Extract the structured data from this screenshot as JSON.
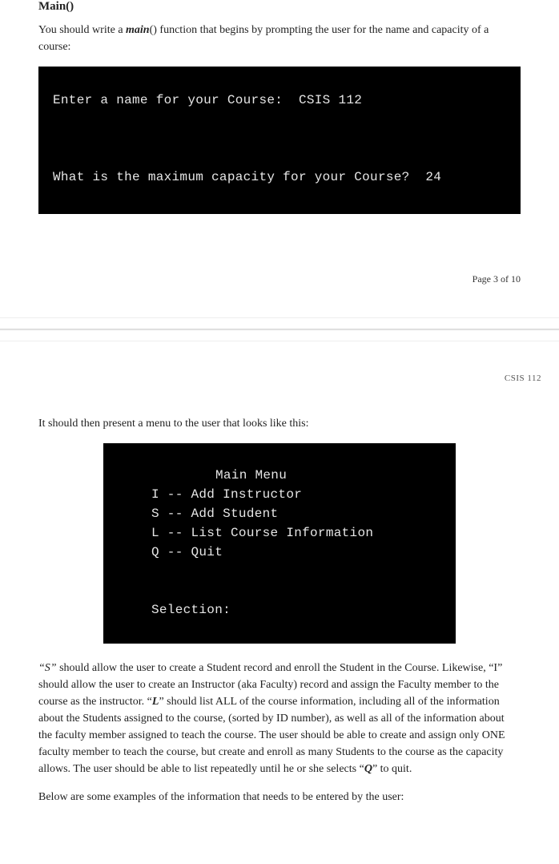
{
  "heading": "Main()",
  "intro_pre": "You should write a ",
  "intro_main": "main",
  "intro_post": "() function that begins by prompting the user for the name and capacity of a course:",
  "console1_line1": "Enter a name for your Course:  CSIS 112",
  "console1_line2": "What is the maximum capacity for your Course?  24",
  "page_num": "Page 3 of 10",
  "course_code": "CSIS 112",
  "menu_intro": "It should then present a menu to the user that looks like this:",
  "menu_title": "Main Menu",
  "menu_i": "I -- Add Instructor",
  "menu_s": "S -- Add Student",
  "menu_l": "L -- List Course Information",
  "menu_q": "Q -- Quit",
  "menu_sel": "Selection:",
  "p2_s": "“S”",
  "p2_1": " should allow the user to create a Student record and enroll the Student in the Course.  Likewise, “I” should allow the user to create an Instructor (aka Faculty) record and assign the Faculty member to the course as the instructor.  “",
  "p2_l": "L",
  "p2_2": "” should list ALL of the course information, including all of the information about the Students assigned to the course, (sorted by ID number), as well as all of the information about the faculty member assigned to teach the course.  The user should be able to create and assign only ONE faculty member to teach the course, but create and enroll as many Students to the course as the capacity allows.  The user should be able to list repeatedly until he or she selects “",
  "p2_q": "Q",
  "p2_3": "” to quit.",
  "p3": "Below are some examples of the information that needs to be entered by the user:"
}
